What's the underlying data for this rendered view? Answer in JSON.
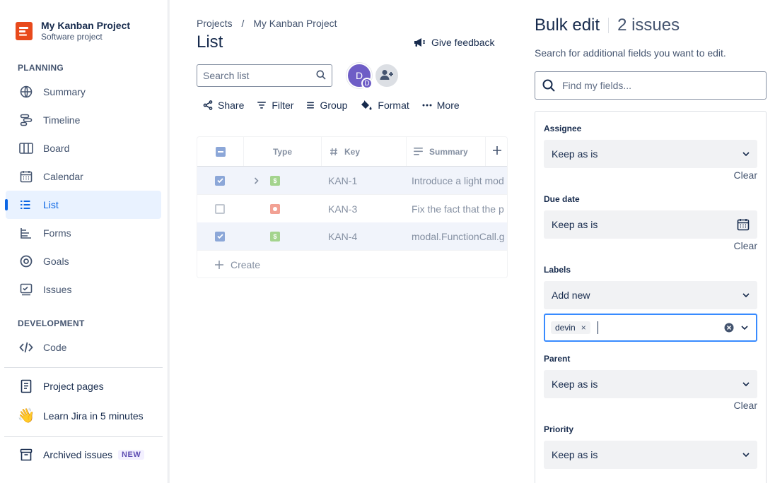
{
  "project": {
    "name": "My Kanban Project",
    "type": "Software project"
  },
  "sidebar": {
    "planning_heading": "PLANNING",
    "planning_items": [
      {
        "label": "Summary",
        "icon": "globe-icon"
      },
      {
        "label": "Timeline",
        "icon": "timeline-icon"
      },
      {
        "label": "Board",
        "icon": "board-icon"
      },
      {
        "label": "Calendar",
        "icon": "calendar-icon"
      },
      {
        "label": "List",
        "icon": "list-icon",
        "active": true
      },
      {
        "label": "Forms",
        "icon": "forms-icon"
      },
      {
        "label": "Goals",
        "icon": "goals-icon"
      },
      {
        "label": "Issues",
        "icon": "issues-icon"
      }
    ],
    "development_heading": "DEVELOPMENT",
    "development_items": [
      {
        "label": "Code",
        "icon": "code-icon"
      }
    ],
    "project_pages": "Project pages",
    "learn_jira": "Learn Jira in 5 minutes",
    "archived_issues": "Archived issues",
    "archived_badge": "NEW"
  },
  "breadcrumb": {
    "root": "Projects",
    "separator": "/",
    "current": "My Kanban Project"
  },
  "page_title": "List",
  "feedback_label": "Give feedback",
  "search": {
    "placeholder": "Search list"
  },
  "avatar": {
    "initial": "D",
    "sub_initial": "D"
  },
  "toolbar": {
    "share": "Share",
    "filter": "Filter",
    "group": "Group",
    "format": "Format",
    "more": "More"
  },
  "table": {
    "headers": {
      "type": "Type",
      "key": "Key",
      "summary": "Summary"
    },
    "rows": [
      {
        "key": "KAN-1",
        "summary": "Introduce a light mod",
        "type": "story",
        "selected": true,
        "expandable": true
      },
      {
        "key": "KAN-3",
        "summary": "Fix the fact that the p",
        "type": "bug",
        "selected": false,
        "expandable": false
      },
      {
        "key": "KAN-4",
        "summary": "modal.FunctionCall.g",
        "type": "story",
        "selected": true,
        "expandable": false
      }
    ],
    "create_label": "Create"
  },
  "bulk_edit": {
    "title": "Bulk edit",
    "count": "2 issues",
    "description": "Search for additional fields you want to edit.",
    "search_placeholder": "Find my fields...",
    "clear_label": "Clear",
    "fields": {
      "assignee": {
        "label": "Assignee",
        "value": "Keep as is"
      },
      "due_date": {
        "label": "Due date",
        "value": "Keep as is"
      },
      "labels": {
        "label": "Labels",
        "value": "Add new",
        "tags": [
          "devin"
        ]
      },
      "parent": {
        "label": "Parent",
        "value": "Keep as is"
      },
      "priority": {
        "label": "Priority",
        "value": "Keep as is"
      }
    }
  },
  "colors": {
    "accent": "#0c66e4",
    "project_logo": "#e84a1c",
    "focus_border": "#388bff",
    "avatar": "#6e5dc6"
  }
}
